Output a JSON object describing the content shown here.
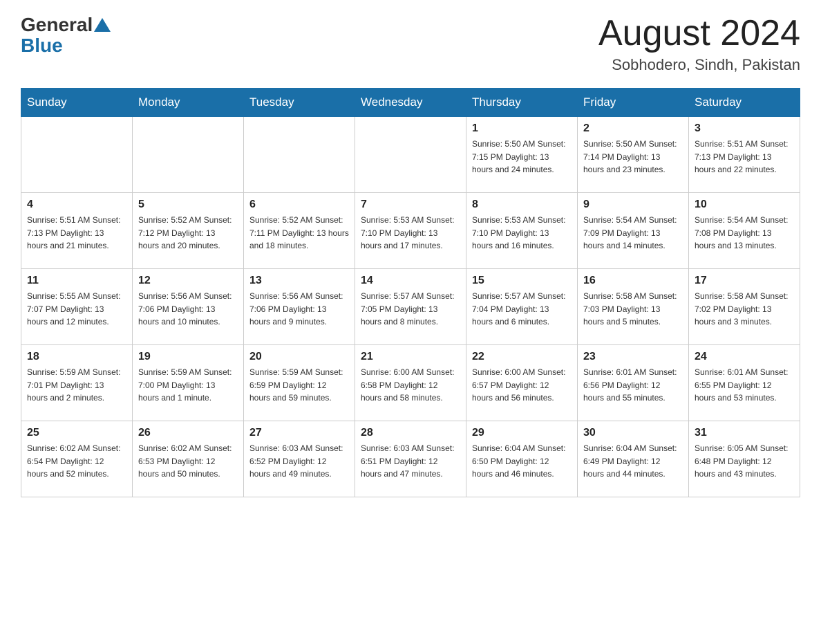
{
  "header": {
    "logo_general": "General",
    "logo_blue": "Blue",
    "title": "August 2024",
    "location": "Sobhodero, Sindh, Pakistan"
  },
  "days_of_week": [
    "Sunday",
    "Monday",
    "Tuesday",
    "Wednesday",
    "Thursday",
    "Friday",
    "Saturday"
  ],
  "weeks": [
    [
      {
        "day": "",
        "info": ""
      },
      {
        "day": "",
        "info": ""
      },
      {
        "day": "",
        "info": ""
      },
      {
        "day": "",
        "info": ""
      },
      {
        "day": "1",
        "info": "Sunrise: 5:50 AM\nSunset: 7:15 PM\nDaylight: 13 hours\nand 24 minutes."
      },
      {
        "day": "2",
        "info": "Sunrise: 5:50 AM\nSunset: 7:14 PM\nDaylight: 13 hours\nand 23 minutes."
      },
      {
        "day": "3",
        "info": "Sunrise: 5:51 AM\nSunset: 7:13 PM\nDaylight: 13 hours\nand 22 minutes."
      }
    ],
    [
      {
        "day": "4",
        "info": "Sunrise: 5:51 AM\nSunset: 7:13 PM\nDaylight: 13 hours\nand 21 minutes."
      },
      {
        "day": "5",
        "info": "Sunrise: 5:52 AM\nSunset: 7:12 PM\nDaylight: 13 hours\nand 20 minutes."
      },
      {
        "day": "6",
        "info": "Sunrise: 5:52 AM\nSunset: 7:11 PM\nDaylight: 13 hours\nand 18 minutes."
      },
      {
        "day": "7",
        "info": "Sunrise: 5:53 AM\nSunset: 7:10 PM\nDaylight: 13 hours\nand 17 minutes."
      },
      {
        "day": "8",
        "info": "Sunrise: 5:53 AM\nSunset: 7:10 PM\nDaylight: 13 hours\nand 16 minutes."
      },
      {
        "day": "9",
        "info": "Sunrise: 5:54 AM\nSunset: 7:09 PM\nDaylight: 13 hours\nand 14 minutes."
      },
      {
        "day": "10",
        "info": "Sunrise: 5:54 AM\nSunset: 7:08 PM\nDaylight: 13 hours\nand 13 minutes."
      }
    ],
    [
      {
        "day": "11",
        "info": "Sunrise: 5:55 AM\nSunset: 7:07 PM\nDaylight: 13 hours\nand 12 minutes."
      },
      {
        "day": "12",
        "info": "Sunrise: 5:56 AM\nSunset: 7:06 PM\nDaylight: 13 hours\nand 10 minutes."
      },
      {
        "day": "13",
        "info": "Sunrise: 5:56 AM\nSunset: 7:06 PM\nDaylight: 13 hours\nand 9 minutes."
      },
      {
        "day": "14",
        "info": "Sunrise: 5:57 AM\nSunset: 7:05 PM\nDaylight: 13 hours\nand 8 minutes."
      },
      {
        "day": "15",
        "info": "Sunrise: 5:57 AM\nSunset: 7:04 PM\nDaylight: 13 hours\nand 6 minutes."
      },
      {
        "day": "16",
        "info": "Sunrise: 5:58 AM\nSunset: 7:03 PM\nDaylight: 13 hours\nand 5 minutes."
      },
      {
        "day": "17",
        "info": "Sunrise: 5:58 AM\nSunset: 7:02 PM\nDaylight: 13 hours\nand 3 minutes."
      }
    ],
    [
      {
        "day": "18",
        "info": "Sunrise: 5:59 AM\nSunset: 7:01 PM\nDaylight: 13 hours\nand 2 minutes."
      },
      {
        "day": "19",
        "info": "Sunrise: 5:59 AM\nSunset: 7:00 PM\nDaylight: 13 hours\nand 1 minute."
      },
      {
        "day": "20",
        "info": "Sunrise: 5:59 AM\nSunset: 6:59 PM\nDaylight: 12 hours\nand 59 minutes."
      },
      {
        "day": "21",
        "info": "Sunrise: 6:00 AM\nSunset: 6:58 PM\nDaylight: 12 hours\nand 58 minutes."
      },
      {
        "day": "22",
        "info": "Sunrise: 6:00 AM\nSunset: 6:57 PM\nDaylight: 12 hours\nand 56 minutes."
      },
      {
        "day": "23",
        "info": "Sunrise: 6:01 AM\nSunset: 6:56 PM\nDaylight: 12 hours\nand 55 minutes."
      },
      {
        "day": "24",
        "info": "Sunrise: 6:01 AM\nSunset: 6:55 PM\nDaylight: 12 hours\nand 53 minutes."
      }
    ],
    [
      {
        "day": "25",
        "info": "Sunrise: 6:02 AM\nSunset: 6:54 PM\nDaylight: 12 hours\nand 52 minutes."
      },
      {
        "day": "26",
        "info": "Sunrise: 6:02 AM\nSunset: 6:53 PM\nDaylight: 12 hours\nand 50 minutes."
      },
      {
        "day": "27",
        "info": "Sunrise: 6:03 AM\nSunset: 6:52 PM\nDaylight: 12 hours\nand 49 minutes."
      },
      {
        "day": "28",
        "info": "Sunrise: 6:03 AM\nSunset: 6:51 PM\nDaylight: 12 hours\nand 47 minutes."
      },
      {
        "day": "29",
        "info": "Sunrise: 6:04 AM\nSunset: 6:50 PM\nDaylight: 12 hours\nand 46 minutes."
      },
      {
        "day": "30",
        "info": "Sunrise: 6:04 AM\nSunset: 6:49 PM\nDaylight: 12 hours\nand 44 minutes."
      },
      {
        "day": "31",
        "info": "Sunrise: 6:05 AM\nSunset: 6:48 PM\nDaylight: 12 hours\nand 43 minutes."
      }
    ]
  ]
}
